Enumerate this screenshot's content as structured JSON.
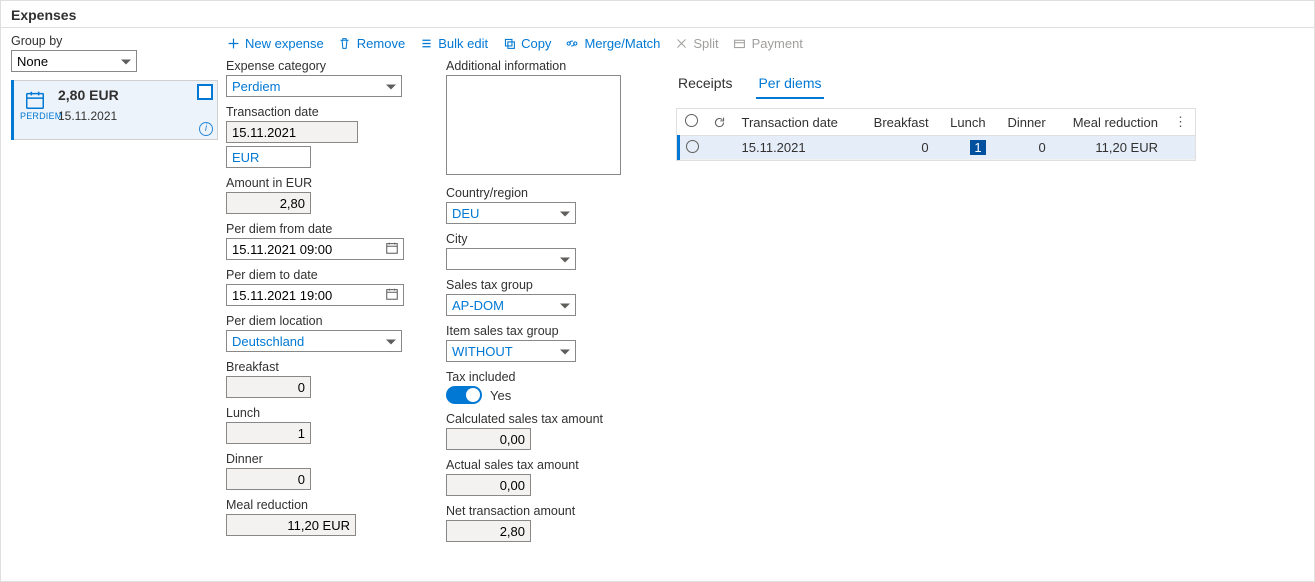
{
  "header": {
    "title": "Expenses"
  },
  "left": {
    "group_by_label": "Group by",
    "group_by_value": "None",
    "card": {
      "icon_label": "PERDIEM",
      "amount": "2,80 EUR",
      "date": "15.11.2021"
    }
  },
  "toolbar": {
    "new_expense": "New expense",
    "remove": "Remove",
    "bulk_edit": "Bulk edit",
    "copy": "Copy",
    "merge_match": "Merge/Match",
    "split": "Split",
    "payment": "Payment"
  },
  "form": {
    "expense_category_label": "Expense category",
    "expense_category_value": "Perdiem",
    "transaction_date_label": "Transaction date",
    "transaction_date_value": "15.11.2021",
    "currency_value": "EUR",
    "amount_label": "Amount in EUR",
    "amount_value": "2,80",
    "from_date_label": "Per diem from date",
    "from_date_value": "15.11.2021 09:00",
    "to_date_label": "Per diem to date",
    "to_date_value": "15.11.2021 19:00",
    "location_label": "Per diem location",
    "location_value": "Deutschland",
    "breakfast_label": "Breakfast",
    "breakfast_value": "0",
    "lunch_label": "Lunch",
    "lunch_value": "1",
    "dinner_label": "Dinner",
    "dinner_value": "0",
    "meal_reduction_label": "Meal reduction",
    "meal_reduction_value": "11,20 EUR",
    "add_info_label": "Additional information",
    "add_info_value": "",
    "country_label": "Country/region",
    "country_value": "DEU",
    "city_label": "City",
    "city_value": "",
    "sales_tax_group_label": "Sales tax group",
    "sales_tax_group_value": "AP-DOM",
    "item_sales_tax_group_label": "Item sales tax group",
    "item_sales_tax_group_value": "WITHOUT",
    "tax_included_label": "Tax included",
    "tax_included_text": "Yes",
    "calc_tax_label": "Calculated sales tax amount",
    "calc_tax_value": "0,00",
    "actual_tax_label": "Actual sales tax amount",
    "actual_tax_value": "0,00",
    "net_amount_label": "Net transaction amount",
    "net_amount_value": "2,80"
  },
  "right": {
    "tab_receipts": "Receipts",
    "tab_per_diems": "Per diems",
    "columns": {
      "transaction_date": "Transaction date",
      "breakfast": "Breakfast",
      "lunch": "Lunch",
      "dinner": "Dinner",
      "meal_reduction": "Meal reduction"
    },
    "row": {
      "date": "15.11.2021",
      "breakfast": "0",
      "lunch": "1",
      "dinner": "0",
      "meal_reduction": "11,20 EUR"
    }
  }
}
